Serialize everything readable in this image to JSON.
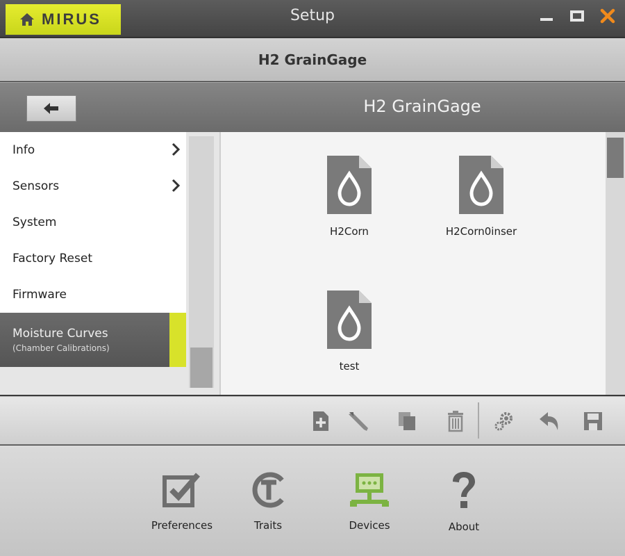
{
  "app": {
    "brand": "MIRUS",
    "window_title": "Setup"
  },
  "device_header": {
    "title": "H2 GrainGage"
  },
  "nav": {
    "title": "H2 GrainGage"
  },
  "menu": {
    "items": [
      {
        "label": "Info",
        "has_submenu": true
      },
      {
        "label": "Sensors",
        "has_submenu": true
      },
      {
        "label": "System",
        "has_submenu": false
      },
      {
        "label": "Factory Reset",
        "has_submenu": false
      },
      {
        "label": "Firmware",
        "has_submenu": false
      }
    ],
    "active": {
      "label": "Moisture Curves",
      "sublabel": "(Chamber Calibrations)"
    }
  },
  "files": [
    {
      "label": "H2Corn",
      "icon": "moisture-file-icon"
    },
    {
      "label": "H2Corn0inser",
      "icon": "moisture-file-icon"
    },
    {
      "label": "test",
      "icon": "moisture-file-icon"
    }
  ],
  "toolbar": {
    "icons": [
      "new-file-icon",
      "edit-pencil-icon",
      "copy-icon",
      "delete-trash-icon",
      "settings-gears-icon",
      "undo-icon",
      "save-disk-icon"
    ]
  },
  "bottom_nav": {
    "items": [
      {
        "label": "Preferences",
        "icon": "checkbox-icon"
      },
      {
        "label": "Traits",
        "icon": "traits-icon"
      },
      {
        "label": "Devices",
        "icon": "devices-icon"
      },
      {
        "label": "About",
        "icon": "question-icon"
      }
    ]
  },
  "colors": {
    "accent": "#d8e22a",
    "close": "#f08a1c",
    "devices_active": "#7cb342",
    "icon_gray": "#6e6e6e"
  }
}
